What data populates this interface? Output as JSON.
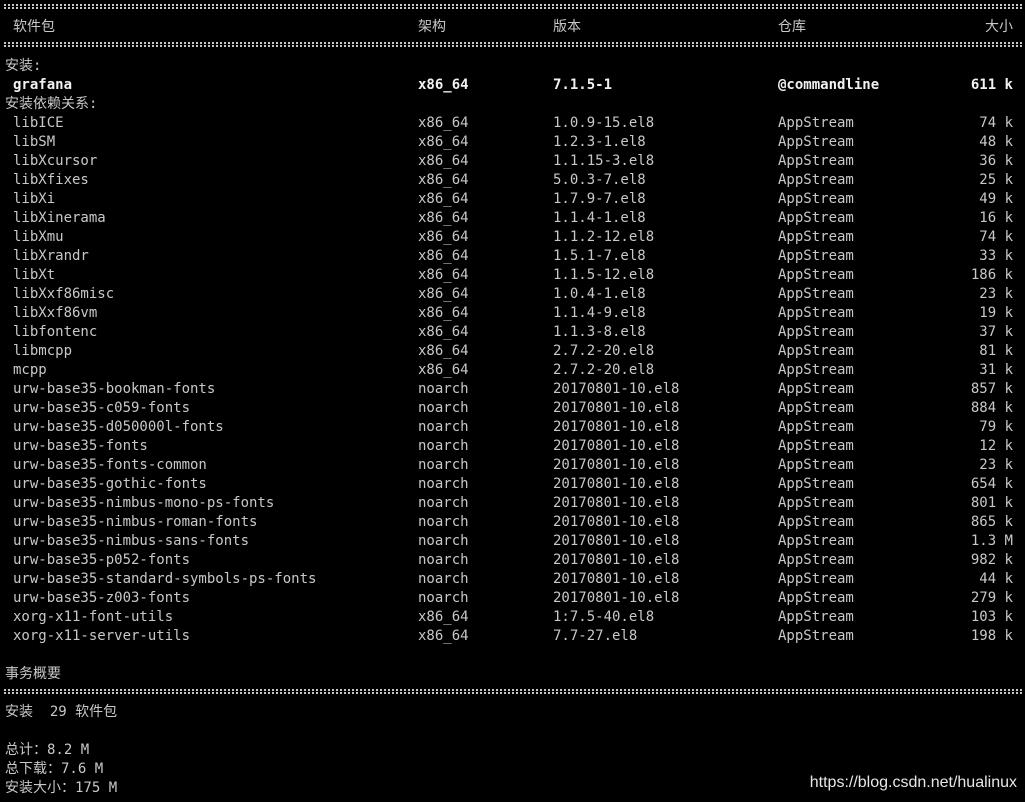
{
  "header": {
    "package": "软件包",
    "arch": "架构",
    "version": "版本",
    "repository": "仓库",
    "size": "大小"
  },
  "sections": {
    "install_heading": "安装:",
    "deps_heading": "安装依赖关系:"
  },
  "installed": [
    {
      "name": "grafana",
      "arch": "x86_64",
      "version": "7.1.5-1",
      "repo": "@commandline",
      "size": "611 k"
    }
  ],
  "dependencies": [
    {
      "name": "libICE",
      "arch": "x86_64",
      "version": "1.0.9-15.el8",
      "repo": "AppStream",
      "size": "74 k"
    },
    {
      "name": "libSM",
      "arch": "x86_64",
      "version": "1.2.3-1.el8",
      "repo": "AppStream",
      "size": "48 k"
    },
    {
      "name": "libXcursor",
      "arch": "x86_64",
      "version": "1.1.15-3.el8",
      "repo": "AppStream",
      "size": "36 k"
    },
    {
      "name": "libXfixes",
      "arch": "x86_64",
      "version": "5.0.3-7.el8",
      "repo": "AppStream",
      "size": "25 k"
    },
    {
      "name": "libXi",
      "arch": "x86_64",
      "version": "1.7.9-7.el8",
      "repo": "AppStream",
      "size": "49 k"
    },
    {
      "name": "libXinerama",
      "arch": "x86_64",
      "version": "1.1.4-1.el8",
      "repo": "AppStream",
      "size": "16 k"
    },
    {
      "name": "libXmu",
      "arch": "x86_64",
      "version": "1.1.2-12.el8",
      "repo": "AppStream",
      "size": "74 k"
    },
    {
      "name": "libXrandr",
      "arch": "x86_64",
      "version": "1.5.1-7.el8",
      "repo": "AppStream",
      "size": "33 k"
    },
    {
      "name": "libXt",
      "arch": "x86_64",
      "version": "1.1.5-12.el8",
      "repo": "AppStream",
      "size": "186 k"
    },
    {
      "name": "libXxf86misc",
      "arch": "x86_64",
      "version": "1.0.4-1.el8",
      "repo": "AppStream",
      "size": "23 k"
    },
    {
      "name": "libXxf86vm",
      "arch": "x86_64",
      "version": "1.1.4-9.el8",
      "repo": "AppStream",
      "size": "19 k"
    },
    {
      "name": "libfontenc",
      "arch": "x86_64",
      "version": "1.1.3-8.el8",
      "repo": "AppStream",
      "size": "37 k"
    },
    {
      "name": "libmcpp",
      "arch": "x86_64",
      "version": "2.7.2-20.el8",
      "repo": "AppStream",
      "size": "81 k"
    },
    {
      "name": "mcpp",
      "arch": "x86_64",
      "version": "2.7.2-20.el8",
      "repo": "AppStream",
      "size": "31 k"
    },
    {
      "name": "urw-base35-bookman-fonts",
      "arch": "noarch",
      "version": "20170801-10.el8",
      "repo": "AppStream",
      "size": "857 k"
    },
    {
      "name": "urw-base35-c059-fonts",
      "arch": "noarch",
      "version": "20170801-10.el8",
      "repo": "AppStream",
      "size": "884 k"
    },
    {
      "name": "urw-base35-d050000l-fonts",
      "arch": "noarch",
      "version": "20170801-10.el8",
      "repo": "AppStream",
      "size": "79 k"
    },
    {
      "name": "urw-base35-fonts",
      "arch": "noarch",
      "version": "20170801-10.el8",
      "repo": "AppStream",
      "size": "12 k"
    },
    {
      "name": "urw-base35-fonts-common",
      "arch": "noarch",
      "version": "20170801-10.el8",
      "repo": "AppStream",
      "size": "23 k"
    },
    {
      "name": "urw-base35-gothic-fonts",
      "arch": "noarch",
      "version": "20170801-10.el8",
      "repo": "AppStream",
      "size": "654 k"
    },
    {
      "name": "urw-base35-nimbus-mono-ps-fonts",
      "arch": "noarch",
      "version": "20170801-10.el8",
      "repo": "AppStream",
      "size": "801 k"
    },
    {
      "name": "urw-base35-nimbus-roman-fonts",
      "arch": "noarch",
      "version": "20170801-10.el8",
      "repo": "AppStream",
      "size": "865 k"
    },
    {
      "name": "urw-base35-nimbus-sans-fonts",
      "arch": "noarch",
      "version": "20170801-10.el8",
      "repo": "AppStream",
      "size": "1.3 M"
    },
    {
      "name": "urw-base35-p052-fonts",
      "arch": "noarch",
      "version": "20170801-10.el8",
      "repo": "AppStream",
      "size": "982 k"
    },
    {
      "name": "urw-base35-standard-symbols-ps-fonts",
      "arch": "noarch",
      "version": "20170801-10.el8",
      "repo": "AppStream",
      "size": "44 k"
    },
    {
      "name": "urw-base35-z003-fonts",
      "arch": "noarch",
      "version": "20170801-10.el8",
      "repo": "AppStream",
      "size": "279 k"
    },
    {
      "name": "xorg-x11-font-utils",
      "arch": "x86_64",
      "version": "1:7.5-40.el8",
      "repo": "AppStream",
      "size": "103 k"
    },
    {
      "name": "xorg-x11-server-utils",
      "arch": "x86_64",
      "version": "7.7-27.el8",
      "repo": "AppStream",
      "size": "198 k"
    }
  ],
  "summary": {
    "heading": "事务概要",
    "install_line": "安装  29 软件包",
    "total": "总计：8.2 M",
    "download": "总下载：7.6 M",
    "installed_size": "安装大小：175 M"
  },
  "watermark": "https://blog.csdn.net/hualinux"
}
